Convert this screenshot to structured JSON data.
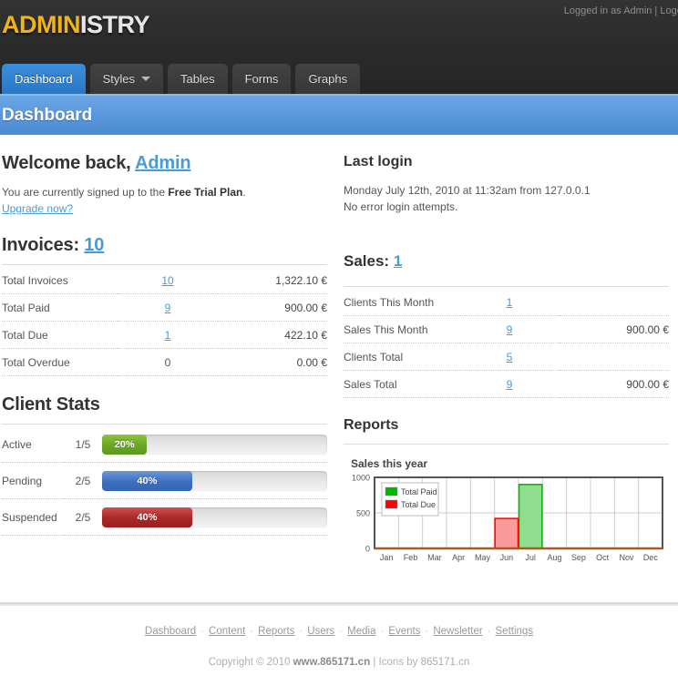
{
  "brand": {
    "name_part1": "ADMIN",
    "name_part2": "ISTRY"
  },
  "account": {
    "label": "Logged in as Admin | Logout"
  },
  "nav": {
    "tabs": [
      {
        "label": "Dashboard",
        "active": true,
        "caret": false
      },
      {
        "label": "Styles",
        "active": false,
        "caret": true
      },
      {
        "label": "Tables",
        "active": false,
        "caret": false
      },
      {
        "label": "Forms",
        "active": false,
        "caret": false
      },
      {
        "label": "Graphs",
        "active": false,
        "caret": false
      }
    ]
  },
  "page": {
    "title": "Dashboard"
  },
  "welcome": {
    "heading_prefix": "Welcome back, ",
    "user": "Admin",
    "line_prefix": "You are currently signed up to the ",
    "plan": "Free Trial Plan",
    "line_suffix": ".",
    "upgrade_link": "Upgrade now?"
  },
  "last_login": {
    "title": "Last login",
    "line1": "Monday July 12th, 2010 at 11:32am from 127.0.0.1",
    "line2": "No error login attempts."
  },
  "invoices": {
    "title": "Invoices:",
    "total": "10",
    "rows": [
      {
        "label": "Total Invoices",
        "count": "10",
        "count_link": true,
        "amount": "1,322.10 €"
      },
      {
        "label": "Total Paid",
        "count": "9",
        "count_link": true,
        "amount": "900.00 €"
      },
      {
        "label": "Total Due",
        "count": "1",
        "count_link": true,
        "amount": "422.10 €"
      },
      {
        "label": "Total Overdue",
        "count": "0",
        "count_link": false,
        "amount": "0.00 €"
      }
    ]
  },
  "sales": {
    "title": "Sales:",
    "total": "1",
    "rows": [
      {
        "label": "Clients This Month",
        "count": "1",
        "count_link": true,
        "amount": ""
      },
      {
        "label": "Sales This Month",
        "count": "9",
        "count_link": true,
        "amount": "900.00 €"
      },
      {
        "label": "Clients Total",
        "count": "5",
        "count_link": true,
        "amount": ""
      },
      {
        "label": "Sales Total",
        "count": "9",
        "count_link": true,
        "amount": "900.00 €"
      }
    ]
  },
  "client_stats": {
    "title": "Client Stats",
    "rows": [
      {
        "label": "Active",
        "fraction": "1/5",
        "percent": "20%",
        "value": 20,
        "color": "green"
      },
      {
        "label": "Pending",
        "fraction": "2/5",
        "percent": "40%",
        "value": 40,
        "color": "blue"
      },
      {
        "label": "Suspended",
        "fraction": "2/5",
        "percent": "40%",
        "value": 40,
        "color": "red"
      }
    ]
  },
  "reports": {
    "title": "Reports"
  },
  "chart_data": {
    "type": "bar",
    "title": "Sales this year",
    "xlabel": "",
    "ylabel": "",
    "ylim": [
      0,
      1000
    ],
    "yticks": [
      0,
      500,
      1000
    ],
    "grid": true,
    "legend_position": "top-left-inside",
    "categories": [
      "Jan",
      "Feb",
      "Mar",
      "Apr",
      "May",
      "Jun",
      "Jul",
      "Aug",
      "Sep",
      "Oct",
      "Nov",
      "Dec"
    ],
    "series": [
      {
        "name": "Total Paid",
        "color": "#00b400",
        "fill": "#90dd90",
        "values": [
          0,
          0,
          0,
          0,
          0,
          0,
          900,
          0,
          0,
          0,
          0,
          0
        ]
      },
      {
        "name": "Total Due",
        "color": "#ff0000",
        "fill": "#fb9a9a",
        "values": [
          0,
          0,
          0,
          0,
          0,
          422,
          0,
          0,
          0,
          0,
          0,
          0
        ]
      }
    ]
  },
  "footer": {
    "links": [
      "Dashboard",
      "Content",
      "Reports",
      "Users",
      "Media",
      "Events",
      "Newsletter",
      "Settings"
    ],
    "separator": "·",
    "copyright_prefix": "Copyright © 2010 ",
    "copyright_site": "www.865171.cn",
    "copyright_mid": " | Icons by ",
    "copyright_icons": "865171.cn"
  }
}
